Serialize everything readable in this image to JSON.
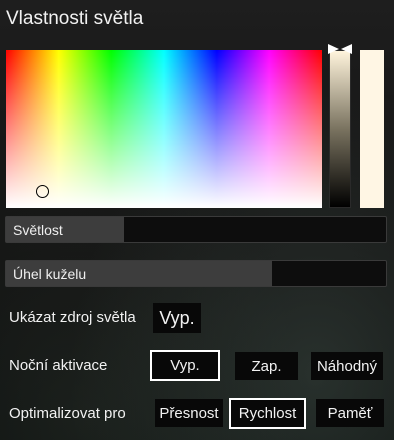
{
  "dialog": {
    "title": "Vlastnosti světla"
  },
  "sliders": {
    "brightness": {
      "label": "Světlost",
      "level": 0.31
    },
    "cone_angle": {
      "label": "Úhel kuželu",
      "level": 0.7
    }
  },
  "show_source": {
    "label": "Ukázat zdroj světla",
    "value": "Vyp."
  },
  "night_activation": {
    "label": "Noční aktivace",
    "options": [
      "Vyp.",
      "Zap.",
      "Náhodný"
    ],
    "selected": "Vyp."
  },
  "optimize_for": {
    "label": "Optimalizovat pro",
    "options": [
      "Přesnost",
      "Rychlost",
      "Paměť"
    ],
    "selected": "Rychlost"
  },
  "colors": {
    "preview": "#fff6e4",
    "selected_border": "#ffffff"
  }
}
